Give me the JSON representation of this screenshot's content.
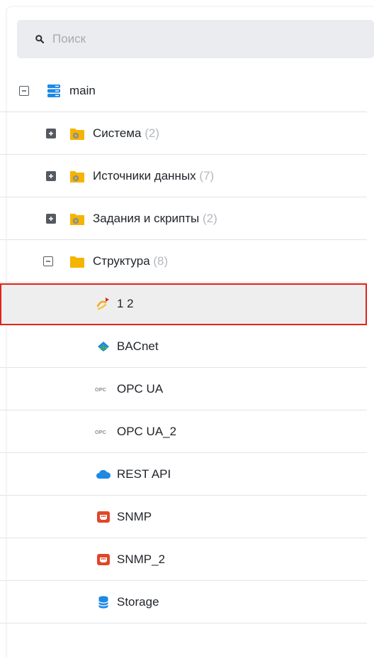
{
  "search": {
    "placeholder": "Поиск",
    "icon": "search-icon"
  },
  "tree": {
    "root": {
      "label": "main",
      "icon": "server-stack-icon",
      "expanded": true
    },
    "groups": [
      {
        "label": "Система",
        "count": "(2)",
        "icon": "folder-gear-icon",
        "expanded": false
      },
      {
        "label": "Источники данных",
        "count": "(7)",
        "icon": "folder-gear-icon",
        "expanded": false
      },
      {
        "label": "Задания и скрипты",
        "count": "(2)",
        "icon": "folder-gear-icon",
        "expanded": false
      },
      {
        "label": "Структура",
        "count": "(8)",
        "icon": "folder-icon",
        "expanded": true
      }
    ],
    "items": [
      {
        "label": "1 2",
        "icon": "transform-icon",
        "selected": true
      },
      {
        "label": "BACnet",
        "icon": "bacnet-icon"
      },
      {
        "label": "OPC UA",
        "icon": "opc-icon"
      },
      {
        "label": "OPC UA_2",
        "icon": "opc-icon"
      },
      {
        "label": "REST API",
        "icon": "cloud-icon"
      },
      {
        "label": "SNMP",
        "icon": "snmp-icon"
      },
      {
        "label": "SNMP_2",
        "icon": "snmp-icon"
      },
      {
        "label": "Storage",
        "icon": "database-icon"
      }
    ]
  },
  "colors": {
    "selection_border": "#e2231a",
    "selection_bg": "#eeeeee",
    "folder": "#f5b400",
    "server": "#1e88e5",
    "count_text": "#b4b8bf"
  }
}
